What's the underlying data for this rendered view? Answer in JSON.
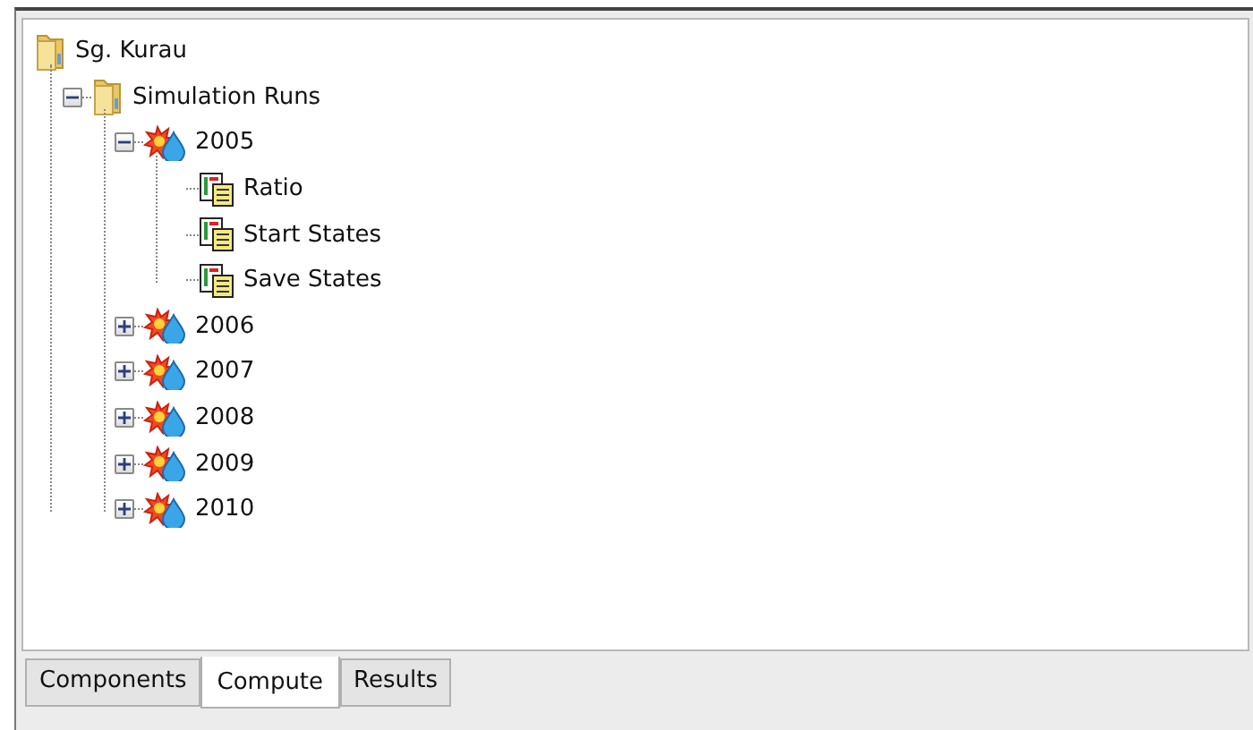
{
  "tree": [
    {
      "label": "Sg. Kurau",
      "kind": "folder",
      "children": [
        {
          "label": "Simulation Runs",
          "kind": "folder",
          "expanded": true,
          "children": [
            {
              "label": "2005",
              "kind": "run",
              "expanded": true,
              "children": [
                {
                  "label": "Ratio",
                  "kind": "item"
                },
                {
                  "label": "Start States",
                  "kind": "item"
                },
                {
                  "label": "Save States",
                  "kind": "item"
                }
              ]
            },
            {
              "label": "2006",
              "kind": "run",
              "expanded": false
            },
            {
              "label": "2007",
              "kind": "run",
              "expanded": false
            },
            {
              "label": "2008",
              "kind": "run",
              "expanded": false
            },
            {
              "label": "2009",
              "kind": "run",
              "expanded": false
            },
            {
              "label": "2010",
              "kind": "run",
              "expanded": false
            }
          ]
        }
      ]
    }
  ],
  "tabs": [
    {
      "label": "Components",
      "selected": false
    },
    {
      "label": "Compute",
      "selected": true
    },
    {
      "label": "Results",
      "selected": false
    }
  ]
}
